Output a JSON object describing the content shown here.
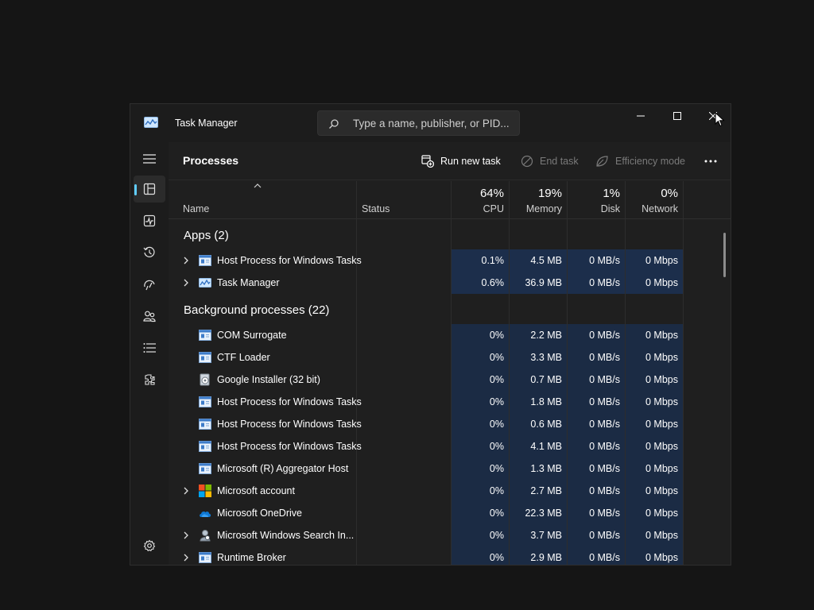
{
  "window": {
    "title": "Task Manager",
    "search_placeholder": "Type a name, publisher, or PID..."
  },
  "nav": {
    "items": [
      {
        "name": "hamburger-menu-icon"
      },
      {
        "name": "processes-icon",
        "active": true
      },
      {
        "name": "performance-icon"
      },
      {
        "name": "app-history-icon"
      },
      {
        "name": "startup-apps-icon"
      },
      {
        "name": "users-icon"
      },
      {
        "name": "details-icon"
      },
      {
        "name": "services-icon"
      },
      {
        "name": "settings-icon"
      }
    ]
  },
  "commandbar": {
    "title": "Processes",
    "run_new_task": "Run new task",
    "end_task": "End task",
    "efficiency_mode": "Efficiency mode"
  },
  "columns": {
    "name": "Name",
    "status": "Status",
    "cpu": {
      "pct": "64%",
      "label": "CPU"
    },
    "memory": {
      "pct": "19%",
      "label": "Memory"
    },
    "disk": {
      "pct": "1%",
      "label": "Disk"
    },
    "network": {
      "pct": "0%",
      "label": "Network"
    }
  },
  "groups": {
    "apps": "Apps (2)",
    "background": "Background processes (22)"
  },
  "apps": [
    {
      "name": "Host Process for Windows Tasks",
      "cpu": "0.1%",
      "memory": "4.5 MB",
      "disk": "0 MB/s",
      "network": "0 Mbps",
      "expandable": true,
      "icon": "window-app-icon"
    },
    {
      "name": "Task Manager",
      "cpu": "0.6%",
      "memory": "36.9 MB",
      "disk": "0 MB/s",
      "network": "0 Mbps",
      "expandable": true,
      "icon": "task-manager-icon"
    }
  ],
  "background": [
    {
      "name": "COM Surrogate",
      "cpu": "0%",
      "memory": "2.2 MB",
      "disk": "0 MB/s",
      "network": "0 Mbps",
      "expandable": false,
      "icon": "window-app-icon"
    },
    {
      "name": "CTF Loader",
      "cpu": "0%",
      "memory": "3.3 MB",
      "disk": "0 MB/s",
      "network": "0 Mbps",
      "expandable": false,
      "icon": "window-app-icon"
    },
    {
      "name": "Google Installer (32 bit)",
      "cpu": "0%",
      "memory": "0.7 MB",
      "disk": "0 MB/s",
      "network": "0 Mbps",
      "expandable": false,
      "icon": "installer-icon"
    },
    {
      "name": "Host Process for Windows Tasks",
      "cpu": "0%",
      "memory": "1.8 MB",
      "disk": "0 MB/s",
      "network": "0 Mbps",
      "expandable": false,
      "icon": "window-app-icon"
    },
    {
      "name": "Host Process for Windows Tasks",
      "cpu": "0%",
      "memory": "0.6 MB",
      "disk": "0 MB/s",
      "network": "0 Mbps",
      "expandable": false,
      "icon": "window-app-icon"
    },
    {
      "name": "Host Process for Windows Tasks",
      "cpu": "0%",
      "memory": "4.1 MB",
      "disk": "0 MB/s",
      "network": "0 Mbps",
      "expandable": false,
      "icon": "window-app-icon"
    },
    {
      "name": "Microsoft (R) Aggregator Host",
      "cpu": "0%",
      "memory": "1.3 MB",
      "disk": "0 MB/s",
      "network": "0 Mbps",
      "expandable": false,
      "icon": "window-app-icon"
    },
    {
      "name": "Microsoft account",
      "cpu": "0%",
      "memory": "2.7 MB",
      "disk": "0 MB/s",
      "network": "0 Mbps",
      "expandable": true,
      "icon": "microsoft-logo-icon"
    },
    {
      "name": "Microsoft OneDrive",
      "cpu": "0%",
      "memory": "22.3 MB",
      "disk": "0 MB/s",
      "network": "0 Mbps",
      "expandable": false,
      "icon": "onedrive-cloud-icon"
    },
    {
      "name": "Microsoft Windows Search In...",
      "cpu": "0%",
      "memory": "3.7 MB",
      "disk": "0 MB/s",
      "network": "0 Mbps",
      "expandable": true,
      "icon": "search-indexer-icon"
    },
    {
      "name": "Runtime Broker",
      "cpu": "0%",
      "memory": "2.9 MB",
      "disk": "0 MB/s",
      "network": "0 Mbps",
      "expandable": true,
      "icon": "window-app-icon"
    }
  ],
  "colors": {
    "accent": "#60cdff",
    "heat_cell": "#1b2b44",
    "window_bg": "#1c1c1c",
    "desktop_bg": "#151515"
  }
}
